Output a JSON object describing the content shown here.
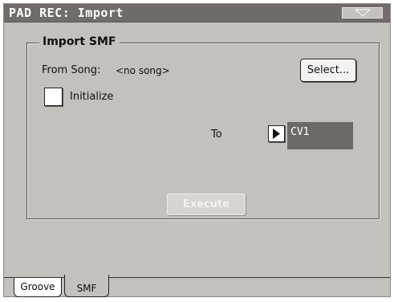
{
  "window": {
    "title": "PAD REC: Import",
    "menu_icon": "triangle-down-icon"
  },
  "import_smf": {
    "group_title": "Import SMF",
    "from_song_label": "From Song:",
    "from_song_value": "<no song>",
    "select_button": "Select...",
    "initialize_label": "Initialize",
    "initialize_checked": false,
    "to_label": "To",
    "to_arrow_icon": "triangle-right-icon",
    "to_value": "CV1",
    "execute_button": "Execute",
    "execute_enabled": false
  },
  "tabs": [
    {
      "label": "Groove",
      "selected": true
    },
    {
      "label": "SMF",
      "selected": false
    }
  ],
  "colors": {
    "panel": "#c4c0bc",
    "title_bar": "#716c69",
    "value_field": "#6e6966"
  }
}
